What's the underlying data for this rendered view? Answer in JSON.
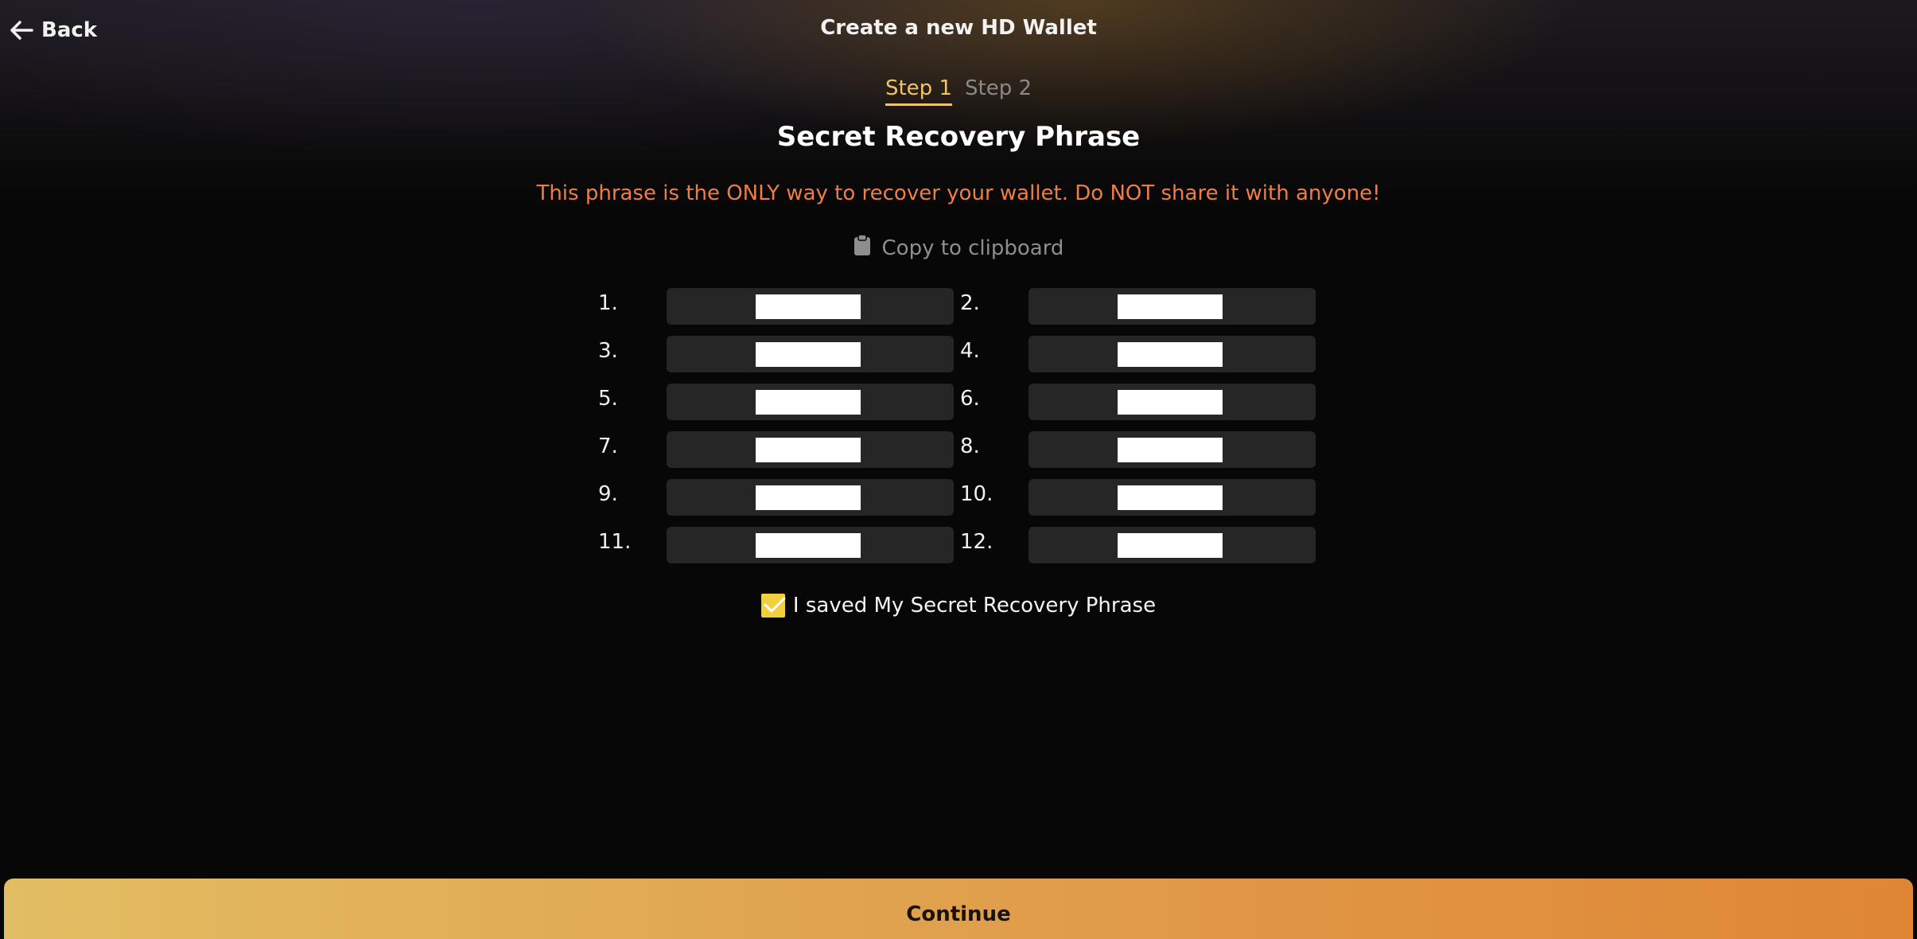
{
  "header": {
    "back_label": "Back",
    "title": "Create a new HD Wallet"
  },
  "steps": [
    {
      "label": "Step 1",
      "active": true
    },
    {
      "label": "Step 2",
      "active": false
    }
  ],
  "main": {
    "heading": "Secret Recovery Phrase",
    "warning": "This phrase is the ONLY way to recover your wallet. Do NOT share it with anyone!",
    "copy_label": "Copy to clipboard",
    "copy_icon": "clipboard-icon",
    "words": [
      {
        "num": "1."
      },
      {
        "num": "2."
      },
      {
        "num": "3."
      },
      {
        "num": "4."
      },
      {
        "num": "5."
      },
      {
        "num": "6."
      },
      {
        "num": "7."
      },
      {
        "num": "8."
      },
      {
        "num": "9."
      },
      {
        "num": "10."
      },
      {
        "num": "11."
      },
      {
        "num": "12."
      }
    ],
    "confirm_label": "I saved My Secret Recovery Phrase",
    "confirm_checked": true
  },
  "footer": {
    "continue_label": "Continue"
  },
  "colors": {
    "accent": "#f3c463",
    "warning": "#ee7e44",
    "checkbox": "#f1cf3f",
    "button_start": "#e2bd63",
    "button_end": "#df8635"
  }
}
